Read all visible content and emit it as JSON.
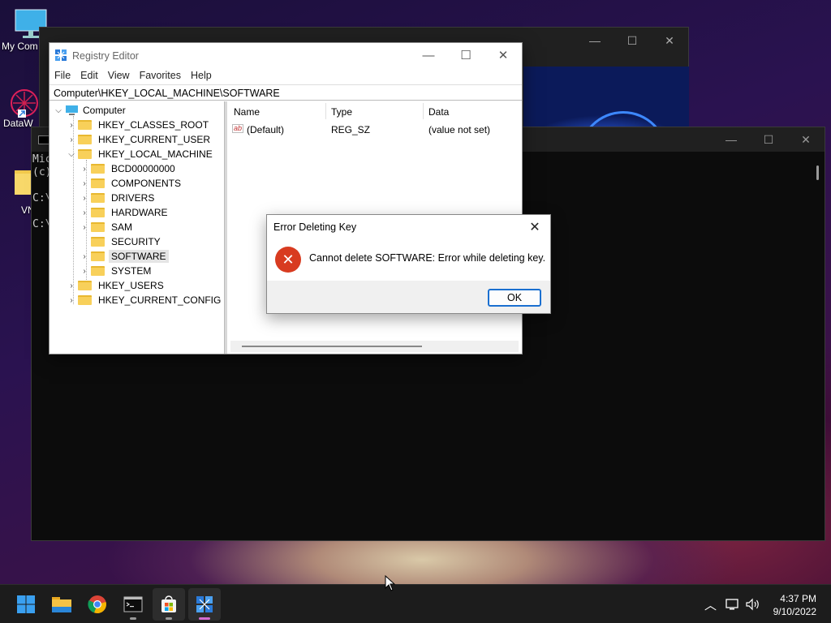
{
  "desktop": {
    "icons": [
      {
        "label": "My Com",
        "icon": "monitor-icon"
      },
      {
        "label": "DataW",
        "icon": "datawrapper-icon"
      },
      {
        "label": "VN",
        "icon": "folder-icon"
      }
    ]
  },
  "console": {
    "lines": [
      "Mic",
      "(c)",
      "",
      "C:\\",
      "C:\\"
    ]
  },
  "regedit": {
    "title": "Registry Editor",
    "menu": [
      "File",
      "Edit",
      "View",
      "Favorites",
      "Help"
    ],
    "address": "Computer\\HKEY_LOCAL_MACHINE\\SOFTWARE",
    "tree": {
      "root": "Computer",
      "hives": [
        "HKEY_CLASSES_ROOT",
        "HKEY_CURRENT_USER",
        "HKEY_LOCAL_MACHINE",
        "HKEY_USERS",
        "HKEY_CURRENT_CONFIG"
      ],
      "hklm_children": [
        "BCD00000000",
        "COMPONENTS",
        "DRIVERS",
        "HARDWARE",
        "SAM",
        "SECURITY",
        "SOFTWARE",
        "SYSTEM"
      ],
      "selected": "SOFTWARE"
    },
    "list": {
      "columns": [
        "Name",
        "Type",
        "Data"
      ],
      "rows": [
        {
          "icon": "ab",
          "name": "(Default)",
          "type": "REG_SZ",
          "data": "(value not set)"
        }
      ]
    }
  },
  "dialog": {
    "title": "Error Deleting Key",
    "message": "Cannot delete SOFTWARE:  Error while deleting key.",
    "ok_label": "OK"
  },
  "taskbar": {
    "apps": [
      "start-icon",
      "file-explorer-icon",
      "chrome-icon",
      "terminal-icon",
      "store-icon",
      "regedit-icon"
    ],
    "time": "4:37 PM",
    "date": "9/10/2022"
  },
  "colors": {
    "accent": "#1a6fd0",
    "error": "#d83b20",
    "folder": "#f8d05a"
  }
}
